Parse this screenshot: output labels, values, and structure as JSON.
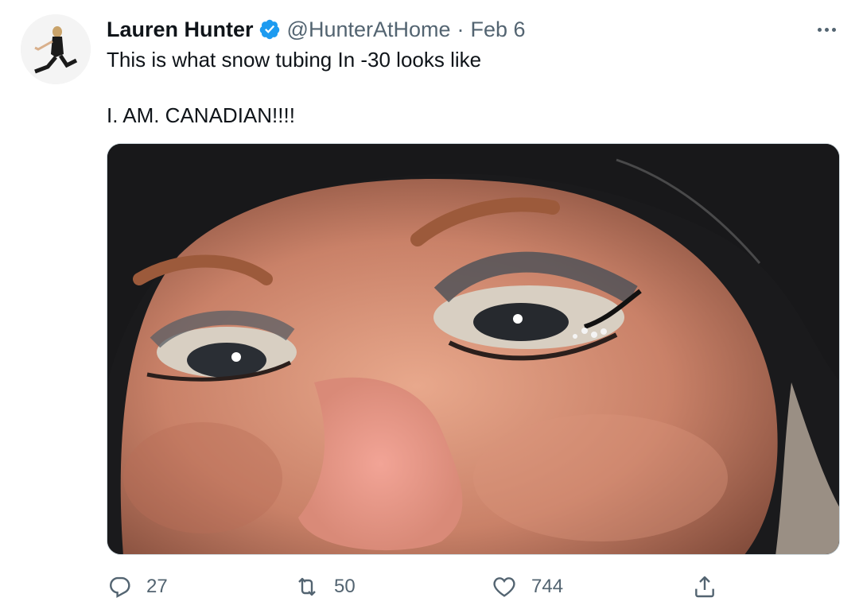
{
  "tweet": {
    "author_name": "Lauren Hunter",
    "handle": "@HunterAtHome",
    "separator": "·",
    "date": "Feb 6",
    "verified": true,
    "text_line1": "This is what snow tubing In -30 looks like",
    "text_line2": "I. AM. CANADIAN!!!!"
  },
  "actions": {
    "reply_count": "27",
    "retweet_count": "50",
    "like_count": "744"
  },
  "icons": {
    "more": "more-icon",
    "verified": "verified-badge-icon",
    "reply": "reply-icon",
    "retweet": "retweet-icon",
    "like": "heart-icon",
    "share": "share-icon"
  },
  "colors": {
    "verified": "#1d9bf0",
    "secondary_text": "#536471",
    "primary_text": "#0f1419"
  }
}
